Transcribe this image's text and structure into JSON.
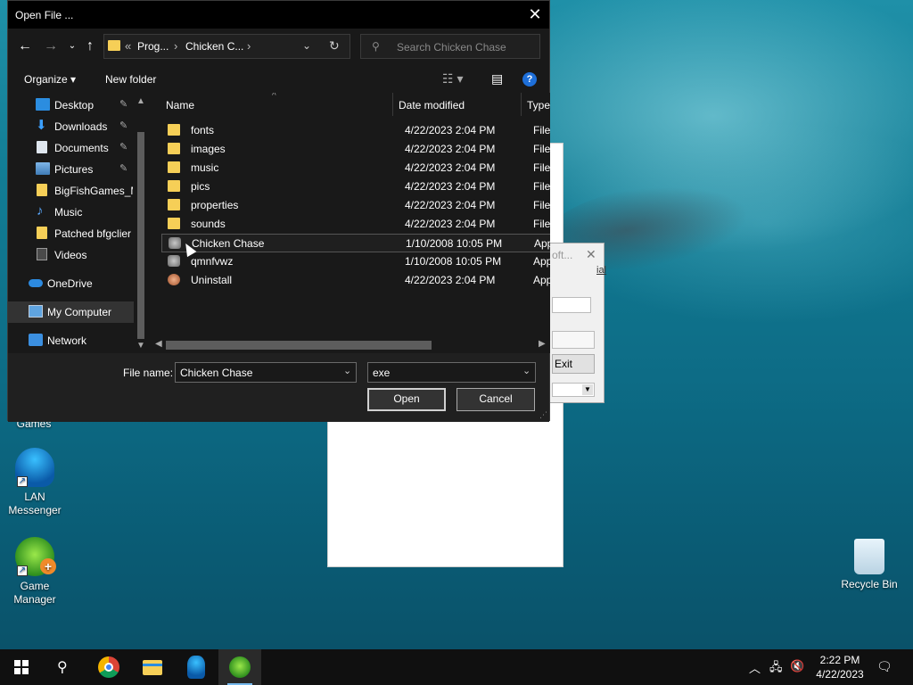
{
  "dialog": {
    "title": "Open File ...",
    "close_glyph": "✕",
    "address": {
      "overflow": "«",
      "crumb1": "Prog...",
      "crumb2": "Chicken C...",
      "sep": "›"
    },
    "search_placeholder": "Search Chicken Chase",
    "toolbar": {
      "organize": "Organize ▾",
      "new_folder": "New folder",
      "help": "?"
    },
    "nav_items": [
      {
        "label": "Desktop",
        "icon": "desktop-icon",
        "pinned": true
      },
      {
        "label": "Downloads",
        "icon": "downloads-icon",
        "pinned": true
      },
      {
        "label": "Documents",
        "icon": "documents-icon",
        "pinned": true
      },
      {
        "label": "Pictures",
        "icon": "pictures-icon",
        "pinned": true
      },
      {
        "label": "BigFishGames_M",
        "icon": "folder-icon",
        "pinned": false
      },
      {
        "label": "Music",
        "icon": "music-icon",
        "pinned": false
      },
      {
        "label": "Patched bfgclier",
        "icon": "folder-icon",
        "pinned": false
      },
      {
        "label": "Videos",
        "icon": "videos-icon",
        "pinned": false
      },
      {
        "label": "OneDrive",
        "icon": "onedrive-icon",
        "pinned": false
      },
      {
        "label": "My Computer",
        "icon": "computer-icon",
        "pinned": false,
        "selected": true
      },
      {
        "label": "Network",
        "icon": "network-icon",
        "pinned": false
      }
    ],
    "columns": {
      "name": "Name",
      "date": "Date modified",
      "type": "Type"
    },
    "files": [
      {
        "name": "fonts",
        "date": "4/22/2023 2:04 PM",
        "type": "File fo",
        "kind": "folder"
      },
      {
        "name": "images",
        "date": "4/22/2023 2:04 PM",
        "type": "File fo",
        "kind": "folder"
      },
      {
        "name": "music",
        "date": "4/22/2023 2:04 PM",
        "type": "File fo",
        "kind": "folder"
      },
      {
        "name": "pics",
        "date": "4/22/2023 2:04 PM",
        "type": "File fo",
        "kind": "folder"
      },
      {
        "name": "properties",
        "date": "4/22/2023 2:04 PM",
        "type": "File fo",
        "kind": "folder"
      },
      {
        "name": "sounds",
        "date": "4/22/2023 2:04 PM",
        "type": "File fo",
        "kind": "folder"
      },
      {
        "name": "Chicken Chase",
        "date": "1/10/2008 10:05 PM",
        "type": "Appli",
        "kind": "app",
        "hover": true
      },
      {
        "name": "qmnfvwz",
        "date": "1/10/2008 10:05 PM",
        "type": "Appli",
        "kind": "app"
      },
      {
        "name": "Uninstall",
        "date": "4/22/2023 2:04 PM",
        "type": "Appli",
        "kind": "uninstall"
      }
    ],
    "filename_label": "File name:",
    "filename_value": "Chicken Chase",
    "filter_value": "exe",
    "open_label": "Open",
    "cancel_label": "Cancel"
  },
  "background_dialog": {
    "title": "oft...",
    "link": "ial",
    "exit_label": "Exit"
  },
  "desktop_icons": [
    {
      "label": "Games"
    },
    {
      "label": "LAN Messenger"
    },
    {
      "label": "Game Manager"
    },
    {
      "label": "Recycle Bin"
    }
  ],
  "taskbar": {
    "time": "2:22 PM",
    "date": "4/22/2023"
  }
}
